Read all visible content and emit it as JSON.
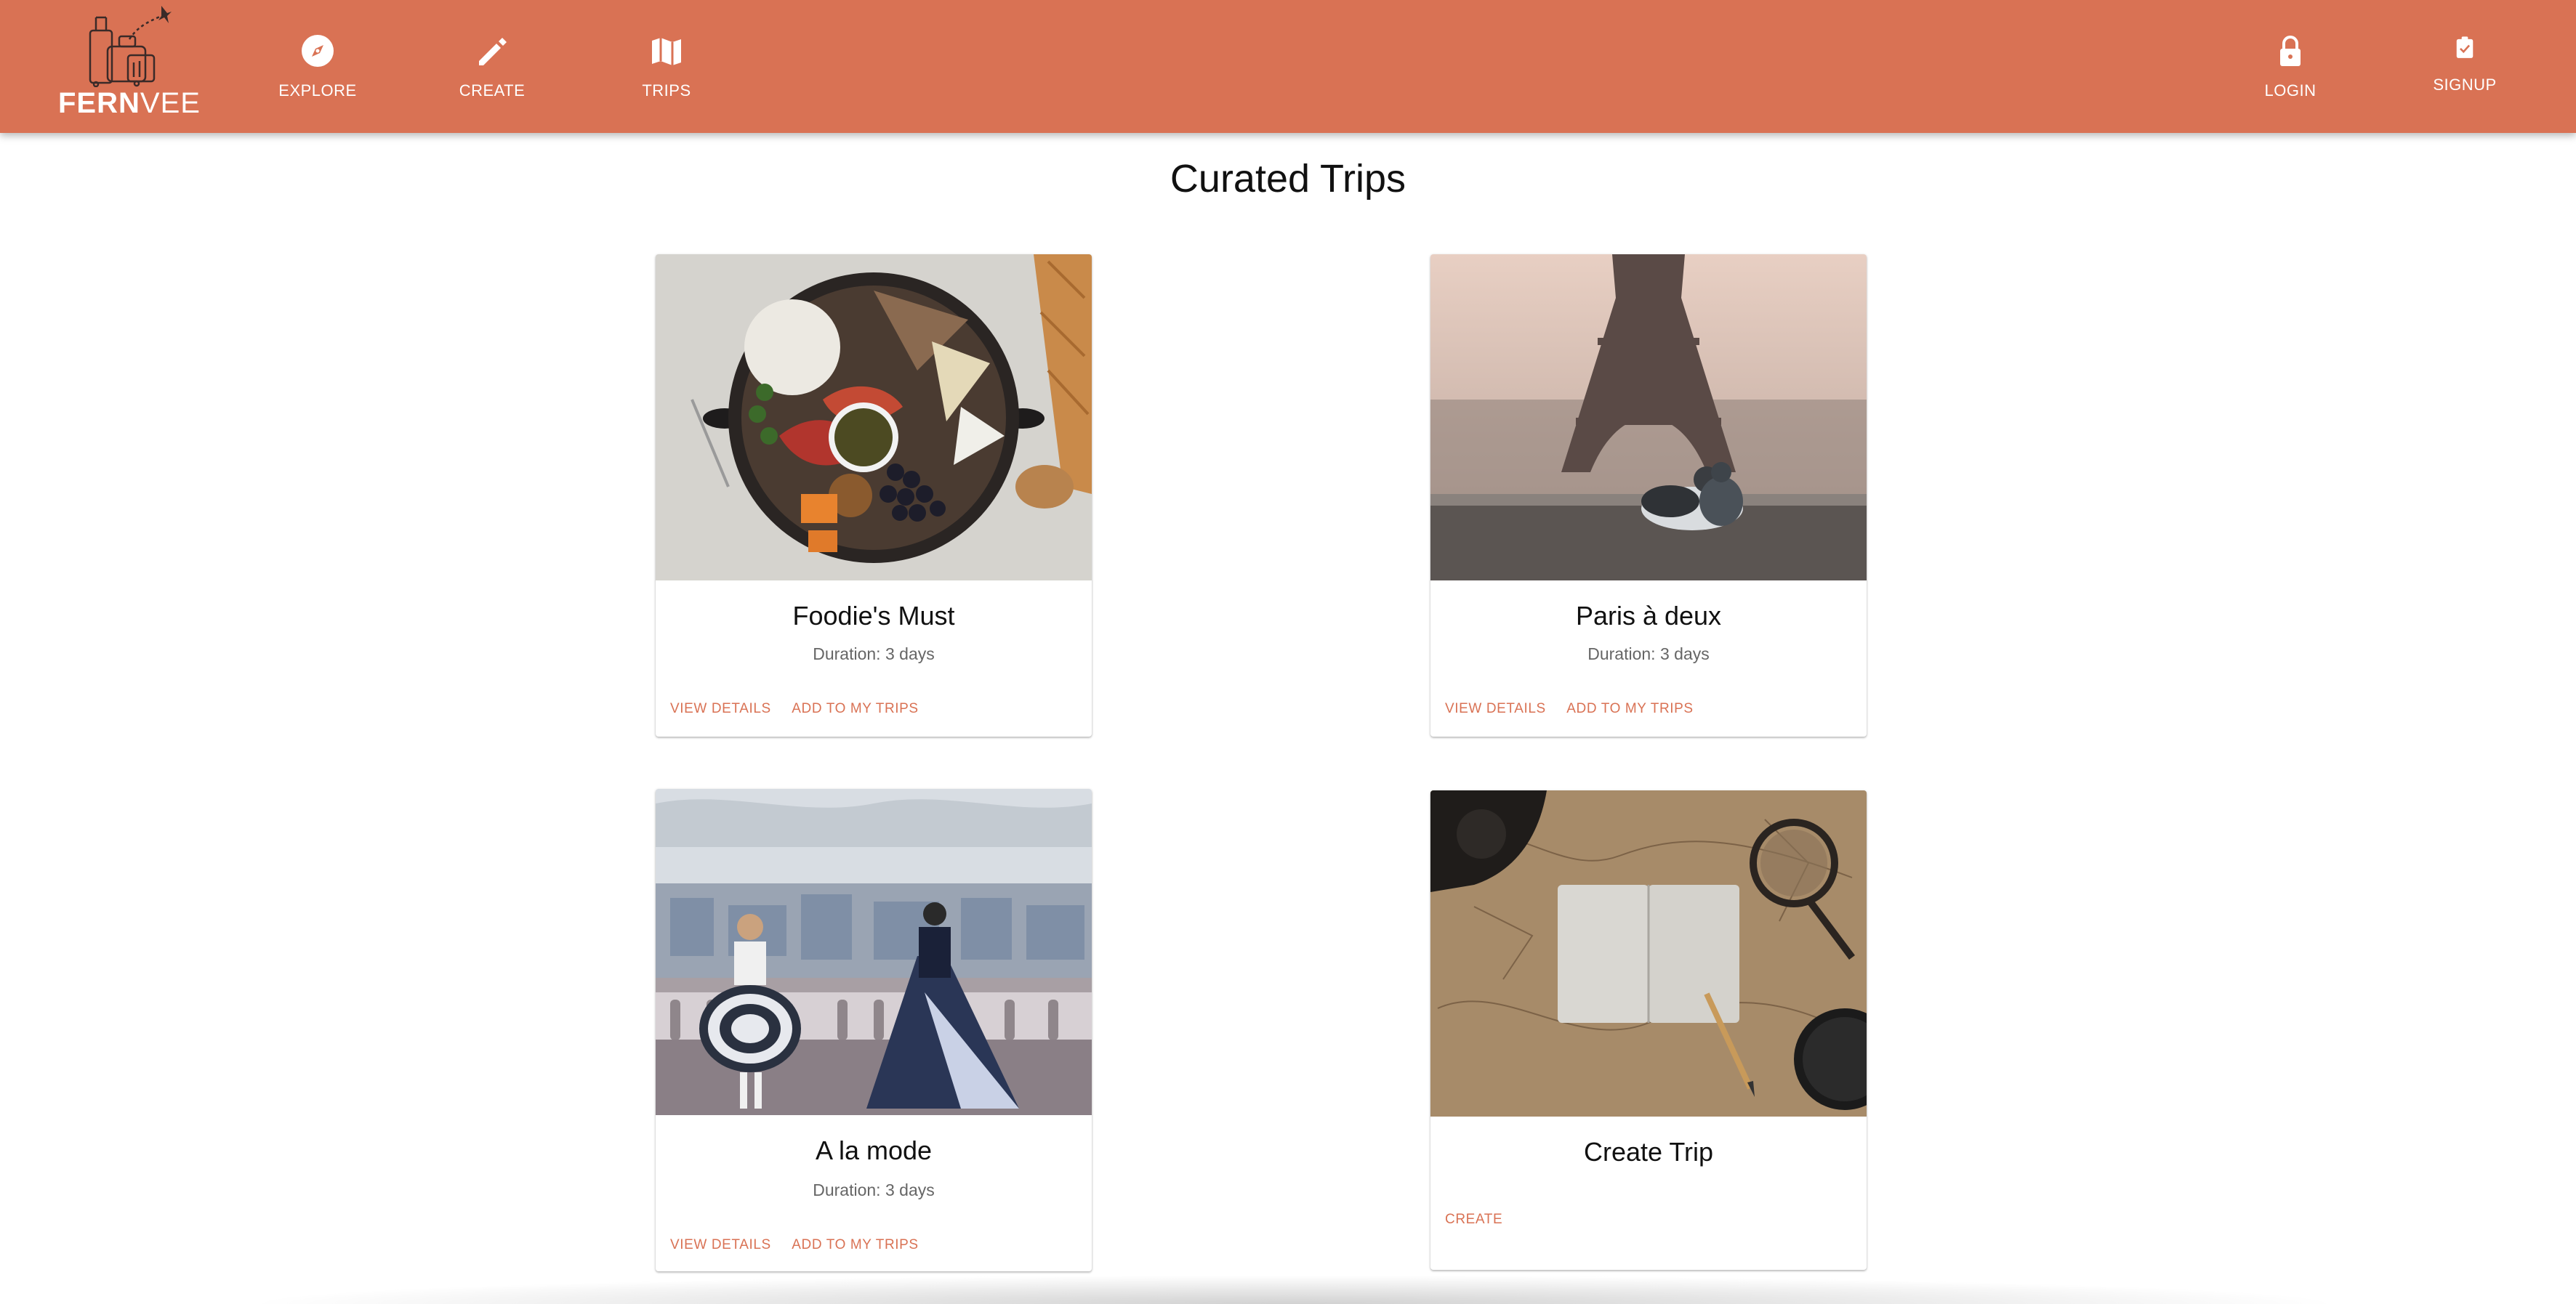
{
  "brand": {
    "name_bold": "FERN",
    "name_light": "VEE"
  },
  "nav": {
    "explore": "EXPLORE",
    "create": "CREATE",
    "trips": "TRIPS",
    "login": "LOGIN",
    "signup": "SIGNUP"
  },
  "page_title": "Curated Trips",
  "cards": [
    {
      "title": "Foodie's Must",
      "duration": "Duration: 3 days",
      "action1": "VIEW DETAILS",
      "action2": "ADD TO MY TRIPS",
      "image": "charcuterie-board"
    },
    {
      "title": "Paris à deux",
      "duration": "Duration: 3 days",
      "action1": "VIEW DETAILS",
      "action2": "ADD TO MY TRIPS",
      "image": "eiffel-tower-pigeons"
    },
    {
      "title": "A la mode",
      "duration": "Duration: 3 days",
      "action1": "VIEW DETAILS",
      "action2": "ADD TO MY TRIPS",
      "image": "paris-fashion-models"
    },
    {
      "title": "Create Trip",
      "action1": "CREATE",
      "image": "map-notebook"
    }
  ],
  "colors": {
    "accent": "#d97254",
    "text": "#111111",
    "muted": "#666666"
  }
}
